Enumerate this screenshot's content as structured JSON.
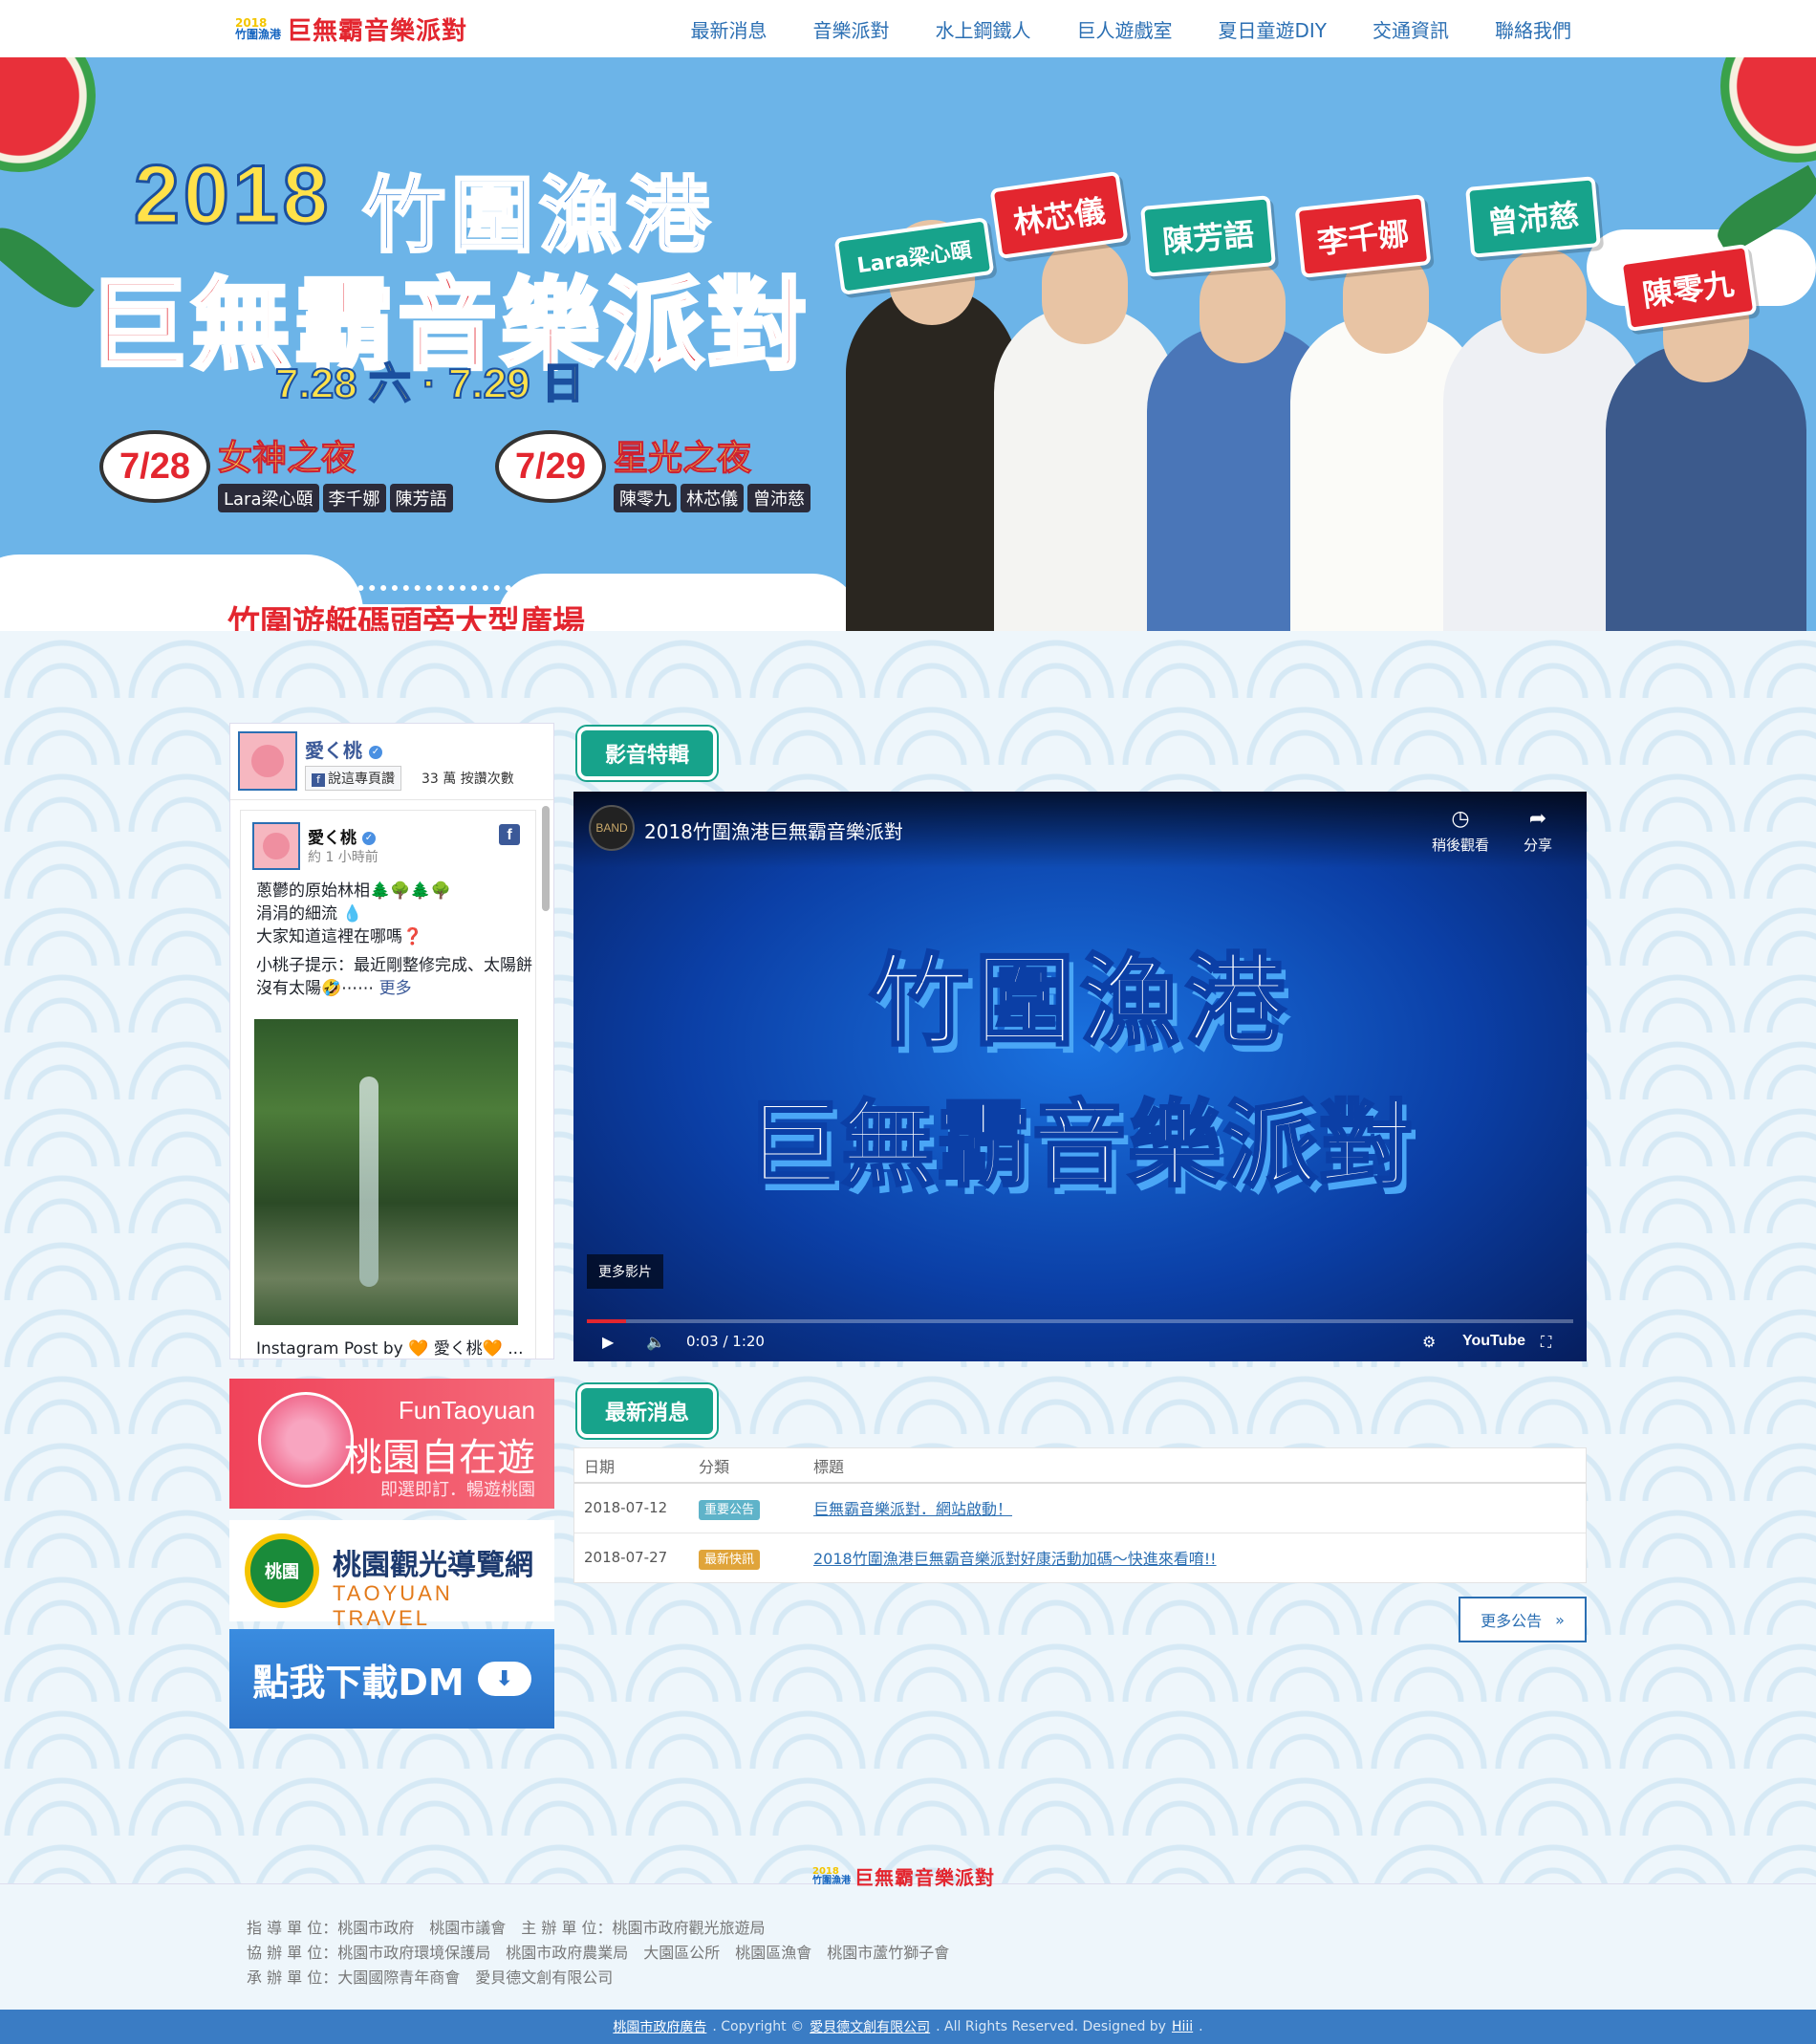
{
  "header": {
    "logo_year": "2018",
    "logo_place": "竹圍漁港",
    "logo_title": "巨無霸音樂派對",
    "nav": [
      "最新消息",
      "音樂派對",
      "水上鋼鐵人",
      "巨人遊戲室",
      "夏日童遊DIY",
      "交通資訊",
      "聯絡我們"
    ]
  },
  "banner": {
    "year": "2018",
    "place": "竹圍漁港",
    "title": "巨無霸音樂派對",
    "dates": "7.28 六 · 7.29 日",
    "night1": {
      "date": "7/28",
      "title": "女神之夜",
      "names": [
        "Lara梁心頤",
        "李千娜",
        "陳芳語"
      ]
    },
    "night2": {
      "date": "7/29",
      "title": "星光之夜",
      "names": [
        "陳零九",
        "林芯儀",
        "曾沛慈"
      ]
    },
    "venue": "竹圍遊艇碼頭旁大型廣場",
    "artists": [
      "Lara梁心頤",
      "林芯儀",
      "陳芳語",
      "李千娜",
      "曾沛慈",
      "陳零九"
    ]
  },
  "facebook": {
    "page_name": "愛く桃",
    "like_label": "說這專頁讚",
    "like_count": "33 萬 按讚次數",
    "post": {
      "author": "愛く桃",
      "time": "約 1 小時前",
      "lines": [
        "蔥鬱的原始林相🌲🌳🌲🌳",
        "涓涓的細流 💧",
        "大家知道這裡在哪嗎❓"
      ],
      "tip": "小桃子提示：最近剛整修完成、太陽餅沒有太陽🤣⋯⋯",
      "more": "更多",
      "caption": "Instagram Post by 🧡 愛く桃🧡 ..."
    }
  },
  "promos": {
    "fun_en": "FunTaoyuan",
    "fun_title": "桃園自在遊",
    "fun_sub": "即選即訂．暢遊桃園",
    "ty_emblem": "桃園",
    "ty_title": "桃園觀光導覽網",
    "ty_en": "TAOYUAN TRAVEL",
    "dm_label": "點我下載DM"
  },
  "video_section": {
    "tab": "影音特輯",
    "channel": "BAND",
    "title": "2018竹圍漁港巨無霸音樂派對",
    "watch_later": "稍後觀看",
    "share": "分享",
    "big_line1": "竹圍漁港",
    "big_line2": "巨無霸音樂派對",
    "more_videos": "更多影片",
    "time": "0:03 / 1:20",
    "progress_fraction": 0.04,
    "youtube": "YouTube"
  },
  "news_section": {
    "tab": "最新消息",
    "headers": [
      "日期",
      "分類",
      "標題"
    ],
    "rows": [
      {
        "date": "2018-07-12",
        "category": "重要公告",
        "category_color": "#5fb3c9",
        "title": "巨無霸音樂派對．網站啟動！"
      },
      {
        "date": "2018-07-27",
        "category": "最新快訊",
        "category_color": "#e0a43a",
        "title": "2018竹圍漁港巨無霸音樂派對好康活動加碼～快進來看唷!!"
      }
    ],
    "more": "更多公告"
  },
  "footer": {
    "logo_year": "2018",
    "logo_place": "竹圍漁港",
    "logo_title": "巨無霸音樂派對",
    "credits": [
      [
        "指 導 單 位：桃園市政府　桃園市議會",
        "主 辦 單 位：桃園市政府觀光旅遊局"
      ],
      [
        "協 辦 單 位：桃園市政府環境保護局　桃園市政府農業局　大園區公所　桃園區漁會　桃園市蘆竹獅子會"
      ],
      [
        "承 辦 單 位：大園國際青年商會　愛貝德文創有限公司"
      ]
    ],
    "bar_link1": "桃園市政府廣告",
    "bar_copy": ". Copyright ©",
    "bar_link2": "愛貝德文創有限公司",
    "bar_rights": ". All Rights Reserved. Designed by",
    "bar_link3": "Hiii",
    "bar_end": "."
  },
  "colors": {
    "accent_red": "#e3262f",
    "teal": "#17a38b",
    "link_blue": "#2b6fb3"
  }
}
